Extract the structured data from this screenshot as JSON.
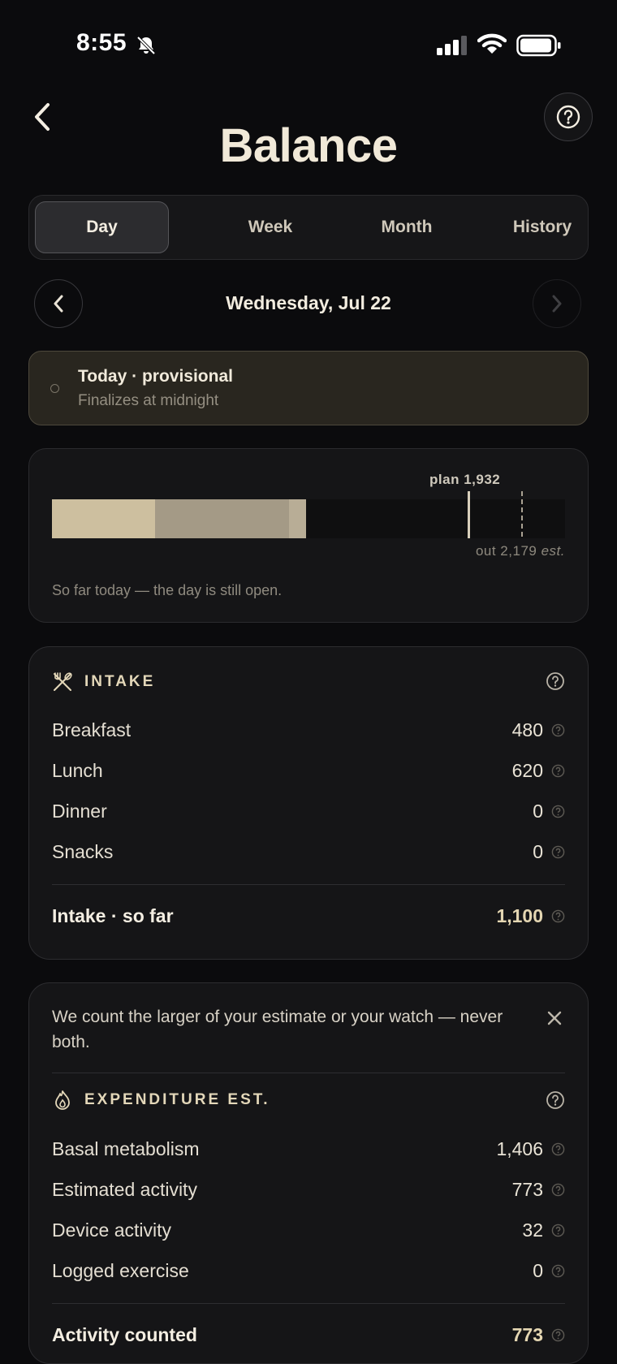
{
  "status_bar": {
    "time": "8:55"
  },
  "header": {
    "title": "Balance"
  },
  "tabs": [
    {
      "label": "Day",
      "active": true
    },
    {
      "label": "Week",
      "active": false
    },
    {
      "label": "Month",
      "active": false
    },
    {
      "label": "History",
      "active": false
    }
  ],
  "date_nav": {
    "label": "Wednesday, Jul 22"
  },
  "banner": {
    "title": "Today · provisional",
    "subtitle": "Finalizes at midnight"
  },
  "balance_bar": {
    "plan_label": "plan 1,932",
    "out_label": "out 2,179",
    "out_suffix": "est.",
    "note": "So far today — the day is still open.",
    "segments": [
      {
        "name": "breakfast",
        "value": 480,
        "color": "#cdbf9f"
      },
      {
        "name": "lunch",
        "value": 620,
        "color": "#a49a86"
      },
      {
        "name": "in-progress",
        "value": 77,
        "color": "#b8ad96"
      }
    ],
    "plan": 1932,
    "out": 2179,
    "scale_max": 2380
  },
  "intake": {
    "title": "INTAKE",
    "rows": [
      {
        "label": "Breakfast",
        "value": "480"
      },
      {
        "label": "Lunch",
        "value": "620"
      },
      {
        "label": "Dinner",
        "value": "0"
      },
      {
        "label": "Snacks",
        "value": "0"
      }
    ],
    "total_label": "Intake · so far",
    "total_value": "1,100"
  },
  "expenditure": {
    "notice": "We count the larger of your estimate or your watch — never both.",
    "title": "EXPENDITURE EST.",
    "rows": [
      {
        "label": "Basal metabolism",
        "value": "1,406"
      },
      {
        "label": "Estimated activity",
        "value": "773"
      },
      {
        "label": "Device activity",
        "value": "32"
      },
      {
        "label": "Logged exercise",
        "value": "0"
      }
    ],
    "total_label": "Activity counted",
    "total_value": "773"
  },
  "colors": {
    "accent": "#e3d7b9",
    "background": "#0b0b0d",
    "card": "#151517",
    "banner": "#29261f"
  }
}
